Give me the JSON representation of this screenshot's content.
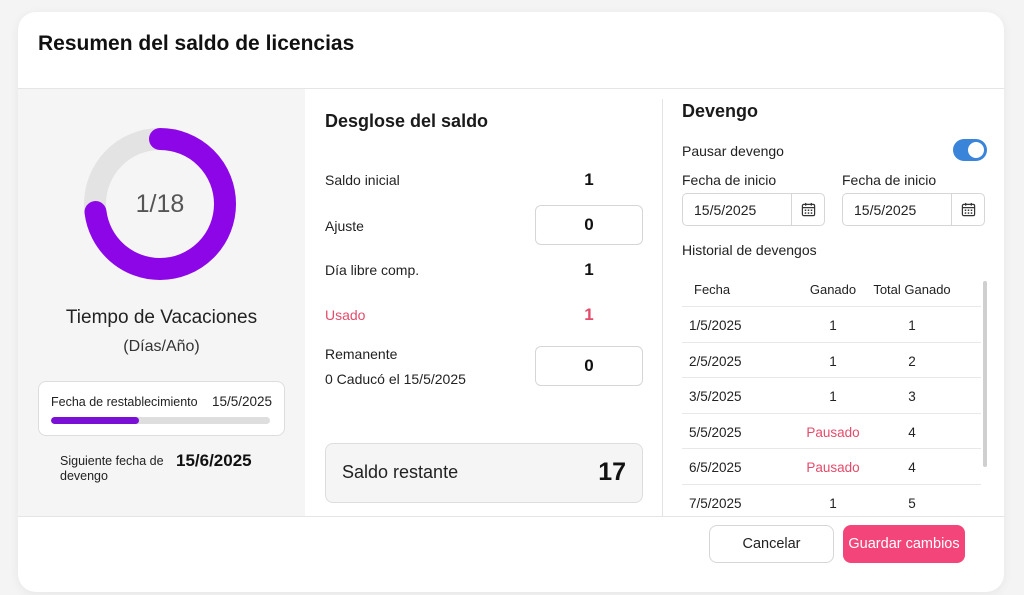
{
  "dialog": {
    "title": "Resumen del saldo de licencias"
  },
  "summary": {
    "donut_text": "1/18",
    "donut_used": 1,
    "donut_total": 18,
    "donut_color": "#8c06e8",
    "donut_track_color": "#e3e3e3",
    "leave_type": "Tiempo de Vacaciones",
    "unit": "(Días/Año)",
    "reset_label": "Fecha de restablecimiento",
    "reset_date": "15/5/2025",
    "reset_progress": 0.4,
    "next_accrual_label": "Siguiente fecha de devengo",
    "next_accrual_date": "15/6/2025"
  },
  "breakdown": {
    "title": "Desglose del saldo",
    "rows": [
      {
        "label": "Saldo inicial",
        "value": "1"
      },
      {
        "label": "Ajuste",
        "value": "0"
      },
      {
        "label": "Día libre comp.",
        "value": "1"
      },
      {
        "label": "Usado",
        "value": "1"
      },
      {
        "label": "Remanente",
        "sublabel": "0 Caducó el 15/5/2025",
        "value": "0"
      }
    ],
    "remaining_label": "Saldo restante",
    "remaining_value": "17"
  },
  "accrual": {
    "title": "Devengo",
    "pause_label": "Pausar devengo",
    "pause_enabled": true,
    "toggle_color": "#3a84d9",
    "start_date_label_1": "Fecha de inicio",
    "start_date_value_1": "15/5/2025",
    "start_date_label_2": "Fecha de inicio",
    "start_date_value_2": "15/5/2025",
    "calendar_icon": "calendar-icon",
    "history_label": "Historial de devengos",
    "history_headers": [
      "Fecha",
      "Ganado",
      "Total Ganado"
    ],
    "history_rows": [
      {
        "date": "1/5/2025",
        "earned": "1",
        "total": "1"
      },
      {
        "date": "2/5/2025",
        "earned": "1",
        "total": "2"
      },
      {
        "date": "3/5/2025",
        "earned": "1",
        "total": "3"
      },
      {
        "date": "5/5/2025",
        "earned": "Pausado",
        "total": "4"
      },
      {
        "date": "6/5/2025",
        "earned": "Pausado",
        "total": "4"
      },
      {
        "date": "7/5/2025",
        "earned": "1",
        "total": "5"
      }
    ]
  },
  "footer": {
    "cancel_label": "Cancelar",
    "save_label": "Guardar cambios",
    "save_color": "#f4457a"
  },
  "colors": {
    "accent_purple": "#7a0fd6",
    "danger_pink": "#e44b6a"
  }
}
